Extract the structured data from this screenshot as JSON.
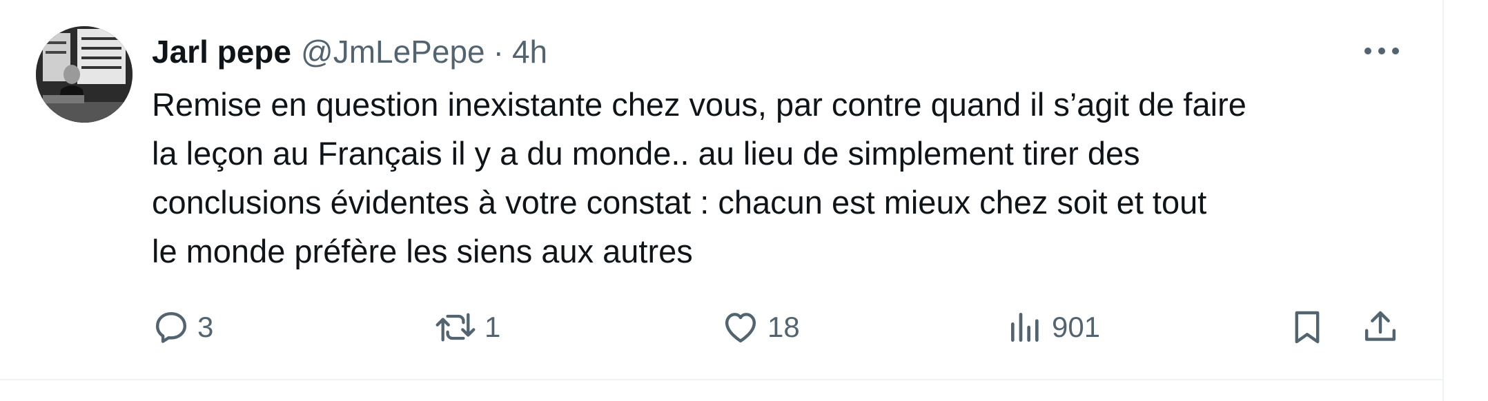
{
  "tweet": {
    "author": {
      "display_name": "Jarl pepe",
      "handle": "@JmLePepe",
      "separator": "·",
      "time": "4h",
      "avatar_icon": "profile-photo"
    },
    "text_lines": [
      "Remise en question inexistante chez vous, par contre quand il s’agit de faire",
      "la leçon au Français il y a du monde.. au lieu de simplement tirer des",
      "conclusions évidentes à votre constat : chacun est mieux chez soit et tout",
      "le monde préfère les siens aux autres"
    ],
    "more_icon": "more-horizontal-icon",
    "actions": {
      "replies": {
        "icon": "reply-icon",
        "count": "3"
      },
      "reposts": {
        "icon": "repost-icon",
        "count": "1"
      },
      "likes": {
        "icon": "heart-icon",
        "count": "18"
      },
      "views": {
        "icon": "views-icon",
        "count": "901"
      },
      "bookmark": {
        "icon": "bookmark-icon"
      },
      "share": {
        "icon": "share-icon"
      }
    }
  },
  "colors": {
    "text_primary": "#0f1419",
    "text_secondary": "#536471",
    "divider": "#eff3f4"
  }
}
